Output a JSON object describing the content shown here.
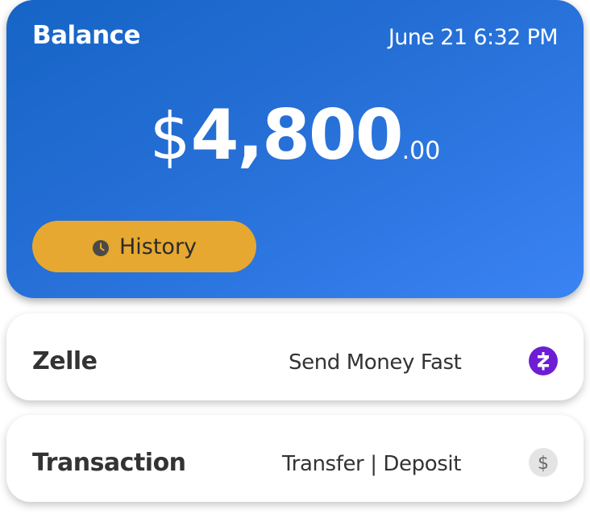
{
  "balance_card": {
    "title": "Balance",
    "datetime": "June 21 6:32 PM",
    "currency_symbol": "$",
    "amount_whole": "4,800",
    "amount_cents": ".00",
    "history_button_label": "History",
    "history_icon": "clock-icon",
    "colors": {
      "card_gradient_start": "#1664c6",
      "card_gradient_end": "#3a83f4",
      "history_button": "#e6a830"
    }
  },
  "rows": {
    "zelle": {
      "title": "Zelle",
      "subtitle": "Send Money Fast",
      "icon": "zelle-logo-icon",
      "icon_color": "#6d1ed4"
    },
    "transaction": {
      "title": "Transaction",
      "subtitle": "Transfer | Deposit",
      "icon": "dollar-icon",
      "icon_color": "#e4e4e4"
    }
  }
}
